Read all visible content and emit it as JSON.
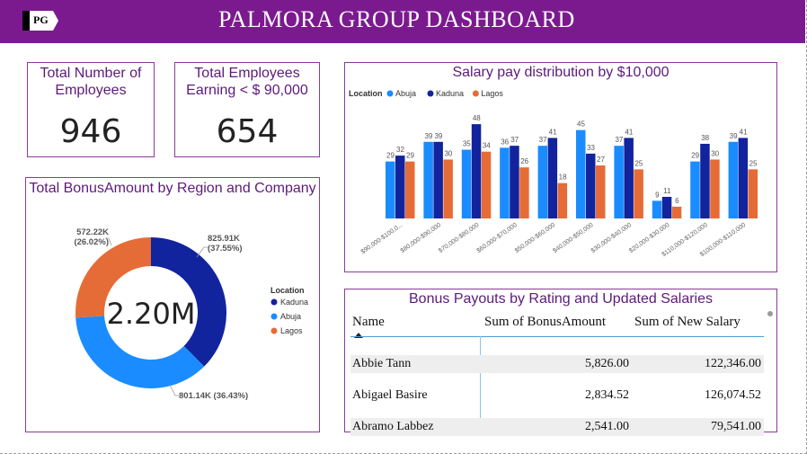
{
  "header": {
    "logo_text": "PG",
    "title": "PALMORA GROUP DASHBOARD"
  },
  "colors": {
    "brand": "#7b1a8f",
    "abuja": "#1a8cff",
    "kaduna": "#12239e",
    "lagos": "#e66c37"
  },
  "kpis": {
    "total_employees": {
      "label": "Total Number of Employees",
      "value": "946"
    },
    "earning_under": {
      "label": "Total Employees Earning < $ 90,000",
      "value": "654"
    }
  },
  "donut": {
    "title": "Total BonusAmount by Region and Company",
    "center_value": "2.20M",
    "legend_title": "Location",
    "segments": [
      {
        "name": "Kaduna",
        "value": 825.91,
        "label": "825.91K",
        "pct_label": "(37.55%)",
        "color": "#12239e"
      },
      {
        "name": "Abuja",
        "value": 801.14,
        "label": "801.14K (36.43%)",
        "color": "#1a8cff"
      },
      {
        "name": "Lagos",
        "value": 572.22,
        "label": "572.22K",
        "pct_label": "(26.02%)",
        "color": "#e66c37"
      }
    ]
  },
  "chart_data": {
    "type": "bar",
    "title": "Salary pay distribution by $10,000",
    "legend_title": "Location",
    "categories": [
      "$90,000-$100,0...",
      "$80,000-$90,000",
      "$70,000-$80,000",
      "$60,000-$70,000",
      "$50,000-$60,000",
      "$40,000-$50,000",
      "$30,000-$40,000",
      "$20,000-$30,000",
      "$110,000-$120,000",
      "$100,000-$110,000"
    ],
    "series": [
      {
        "name": "Abuja",
        "color": "#1a8cff",
        "values": [
          29,
          39,
          35,
          36,
          37,
          45,
          37,
          9,
          29,
          39
        ]
      },
      {
        "name": "Kaduna",
        "color": "#12239e",
        "values": [
          32,
          39,
          48,
          37,
          41,
          33,
          41,
          11,
          38,
          41
        ]
      },
      {
        "name": "Lagos",
        "color": "#e66c37",
        "values": [
          29,
          30,
          34,
          26,
          18,
          27,
          25,
          6,
          30,
          25
        ]
      }
    ],
    "ylim": [
      0,
      50
    ],
    "grid": false,
    "legend_position": "top-left"
  },
  "table": {
    "title": "Bonus Payouts by Rating and Updated Salaries",
    "columns": [
      "Name",
      "Sum of BonusAmount",
      "Sum of New Salary"
    ],
    "rows": [
      [
        "Abbie Tann",
        "5,826.00",
        "122,346.00"
      ],
      [
        "Abigael Basire",
        "2,834.52",
        "126,074.52"
      ],
      [
        "Abramo Labbez",
        "2,541.00",
        "79,541.00"
      ]
    ]
  }
}
